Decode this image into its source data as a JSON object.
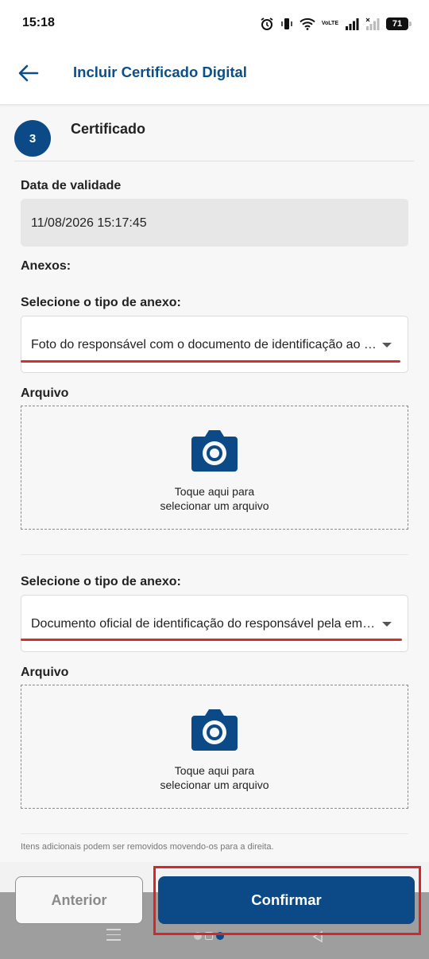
{
  "status_bar": {
    "time": "15:18",
    "volte_top": "Vo",
    "volte_bottom": "LTE",
    "battery": "71"
  },
  "header": {
    "title": "Incluir Certificado Digital",
    "back_icon": "arrow-left-icon"
  },
  "step": {
    "number": "3",
    "title": "Certificado"
  },
  "validity": {
    "label": "Data de validade",
    "value": "11/08/2026 15:17:45"
  },
  "attachments": {
    "label": "Anexos:",
    "items": [
      {
        "select_label": "Selecione o tipo de anexo:",
        "selected": "Foto do responsável com o documento de identificação ao lado do rosto",
        "file_label": "Arquivo",
        "upload_line1": "Toque aqui para",
        "upload_line2": "selecionar um arquivo"
      },
      {
        "select_label": "Selecione o tipo de anexo:",
        "selected": "Documento oficial de identificação do responsável pela empresa",
        "file_label": "Arquivo",
        "upload_line1": "Toque aqui para",
        "upload_line2": "selecionar um arquivo"
      }
    ]
  },
  "hint": "Itens adicionais podem ser removidos movendo-os para a direita.",
  "footer": {
    "prev_label": "Anterior",
    "confirm_label": "Confirmar"
  },
  "colors": {
    "primary": "#0b4a86",
    "highlight": "#d6262b"
  }
}
